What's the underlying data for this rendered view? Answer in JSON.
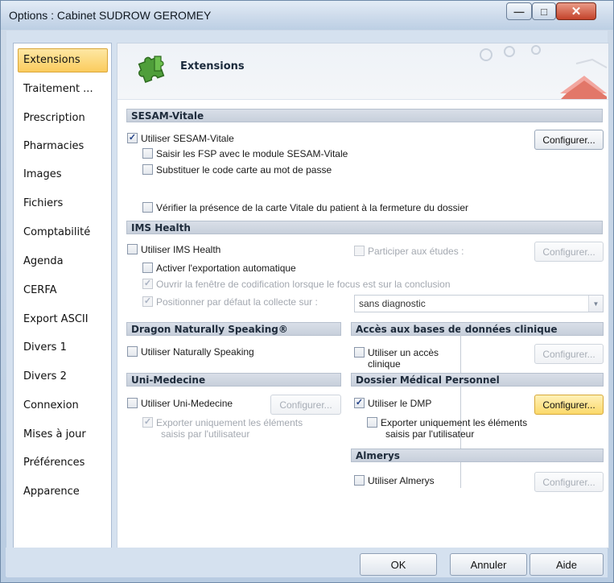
{
  "window": {
    "title": "Options : Cabinet SUDROW GEROMEY"
  },
  "sidebar": {
    "items": [
      {
        "label": "Extensions",
        "active": true
      },
      {
        "label": "Traitement ..."
      },
      {
        "label": "Prescription"
      },
      {
        "label": "Pharmacies"
      },
      {
        "label": "Images"
      },
      {
        "label": "Fichiers"
      },
      {
        "label": "Comptabilité"
      },
      {
        "label": "Agenda"
      },
      {
        "label": "CERFA"
      },
      {
        "label": "Export ASCII"
      },
      {
        "label": "Divers 1"
      },
      {
        "label": "Divers 2"
      },
      {
        "label": "Connexion"
      },
      {
        "label": "Mises à jour"
      },
      {
        "label": "Préférences"
      },
      {
        "label": "Apparence"
      }
    ]
  },
  "banner": {
    "title": "Extensions",
    "icon": "puzzle-icon"
  },
  "sesam": {
    "header": "SESAM-Vitale",
    "use_label": "Utiliser SESAM-Vitale",
    "use_checked": true,
    "fsp_label": "Saisir les FSP avec le module SESAM-Vitale",
    "fsp_checked": false,
    "code_label": "Substituer le code carte au mot de passe",
    "code_checked": false,
    "verify_label": "Vérifier la présence de la carte Vitale du patient à la fermeture du dossier",
    "verify_checked": false,
    "configure_label": "Configurer..."
  },
  "ims": {
    "header": "IMS Health",
    "use_label": "Utiliser IMS Health",
    "studies_label": "Participer aux études :",
    "configure_label": "Configurer...",
    "export_label": "Activer l'exportation automatique",
    "window_label": "Ouvrir la fenêtre de codification lorsque le focus est sur la conclusion",
    "position_label": "Positionner par défaut la collecte sur :",
    "position_value": "sans diagnostic"
  },
  "dragon": {
    "header": "Dragon Naturally Speaking®",
    "use_label": "Utiliser Naturally Speaking"
  },
  "access": {
    "header": "Accès aux bases de données clinique",
    "use_label_line1": "Utiliser un accès",
    "use_label_line2": "clinique",
    "configure_label": "Configurer..."
  },
  "uni": {
    "header": "Uni-Medecine",
    "use_label": "Utiliser Uni-Medecine",
    "configure_label": "Configurer...",
    "export_label_line1": "Exporter uniquement les éléments",
    "export_label_line2": "saisis par l'utilisateur"
  },
  "dmp": {
    "header": "Dossier Médical Personnel",
    "use_label": "Utiliser le DMP",
    "use_checked": true,
    "configure_label": "Configurer...",
    "export_label_line1": "Exporter uniquement les éléments",
    "export_label_line2": "saisis par l'utilisateur"
  },
  "almerys": {
    "header": "Almerys",
    "use_label": "Utiliser Almerys",
    "configure_label": "Configurer..."
  },
  "footer": {
    "ok_label": "OK",
    "cancel_label": "Annuler",
    "help_label": "Aide"
  },
  "check_glyph": "✓",
  "window_controls": {
    "min": "—",
    "max": "□",
    "close": "✕"
  },
  "colors": {
    "active_tab": "#fbcc5e",
    "hot_button": "#fbd96a",
    "section_header": "#c7cfdb",
    "title_bar": "#cfdcec"
  }
}
